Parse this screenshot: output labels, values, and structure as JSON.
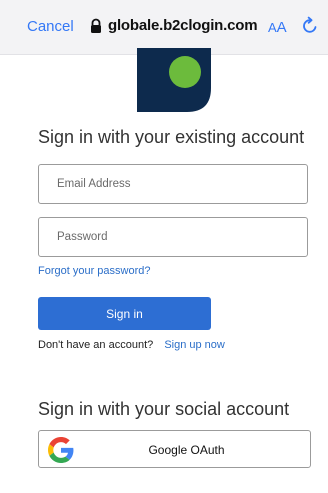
{
  "browser": {
    "cancel_label": "Cancel",
    "url": "globale.b2clogin.com",
    "text_size_label_small": "A",
    "text_size_label_large": "A",
    "lock_icon": "lock-icon",
    "reload_icon": "reload-icon"
  },
  "logo": {
    "icon": "brand-logo-icon",
    "colors": {
      "square": "#0d2a4d",
      "circle": "#6cbb3c"
    }
  },
  "signin": {
    "heading": "Sign in with your existing account",
    "email_placeholder": "Email Address",
    "password_placeholder": "Password",
    "forgot_link": "Forgot your password?",
    "button_label": "Sign in",
    "no_account_text": "Don't have an account?",
    "signup_link": "Sign up now"
  },
  "social": {
    "heading": "Sign in with your social account",
    "google_label": "Google OAuth",
    "google_icon": "google-icon"
  },
  "colors": {
    "accent": "#3478f6",
    "link": "#2b6ec8",
    "button": "#2d6ed3"
  }
}
